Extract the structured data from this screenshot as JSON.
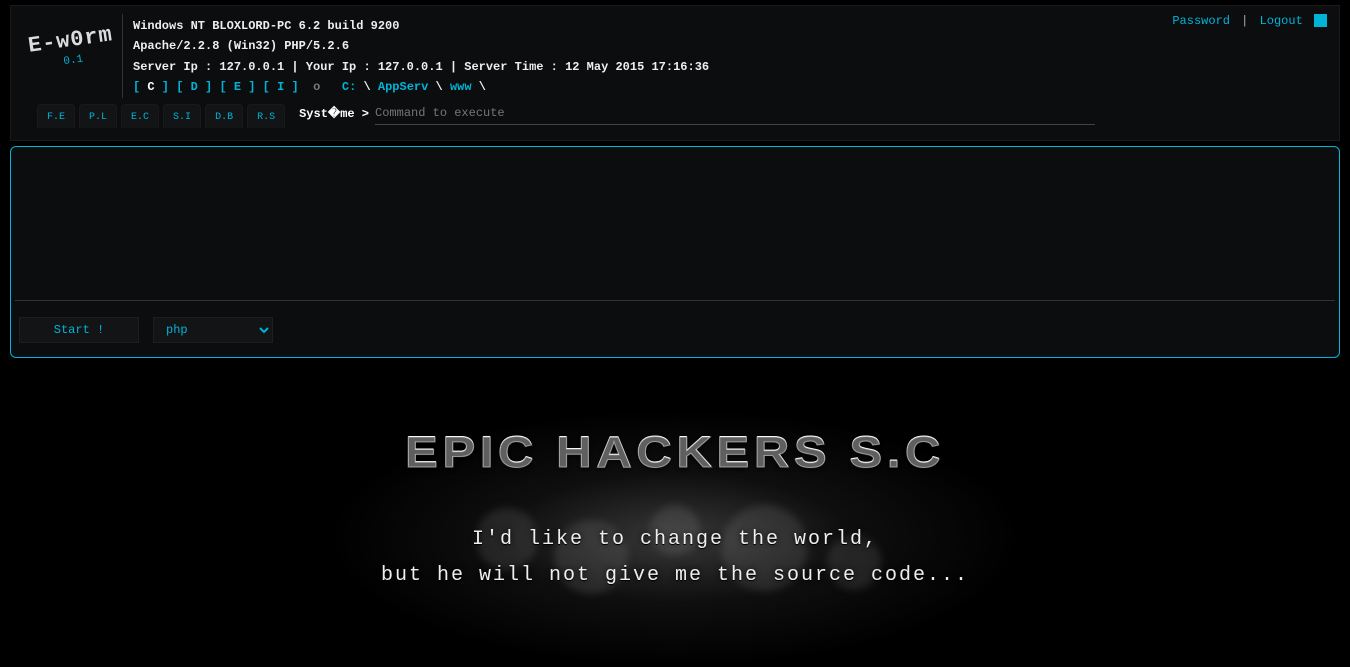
{
  "header": {
    "logo_name": "E-w0rm",
    "logo_version": "0.1",
    "password_link": "Password",
    "logout_link": "Logout",
    "info_os": "Windows NT BLOXLORD-PC 6.2 build 9200",
    "info_server": "Apache/2.2.8 (Win32) PHP/5.2.6",
    "info_ips": "Server Ip : 127.0.0.1 | Your Ip : 127.0.0.1 | Server Time : 12 May 2015 17:16:36",
    "drives": [
      "C",
      "D",
      "E",
      "I"
    ],
    "drive_suffix": "o",
    "path_parts": [
      "C:",
      "AppServ",
      "www"
    ]
  },
  "tabs": [
    {
      "label": "F.E"
    },
    {
      "label": "P.L"
    },
    {
      "label": "E.C"
    },
    {
      "label": "S.I"
    },
    {
      "label": "D.B"
    },
    {
      "label": "R.S"
    }
  ],
  "console": {
    "prompt": "Syst�me >",
    "input_placeholder": "Command to execute",
    "start_button": "Start !",
    "lang_selected": "php",
    "textarea_value": ""
  },
  "footer": {
    "title": "EPIC HACKERS S.C",
    "subtitle_line1": "I'd like to change the world,",
    "subtitle_line2": "but he will not give me the source code..."
  }
}
